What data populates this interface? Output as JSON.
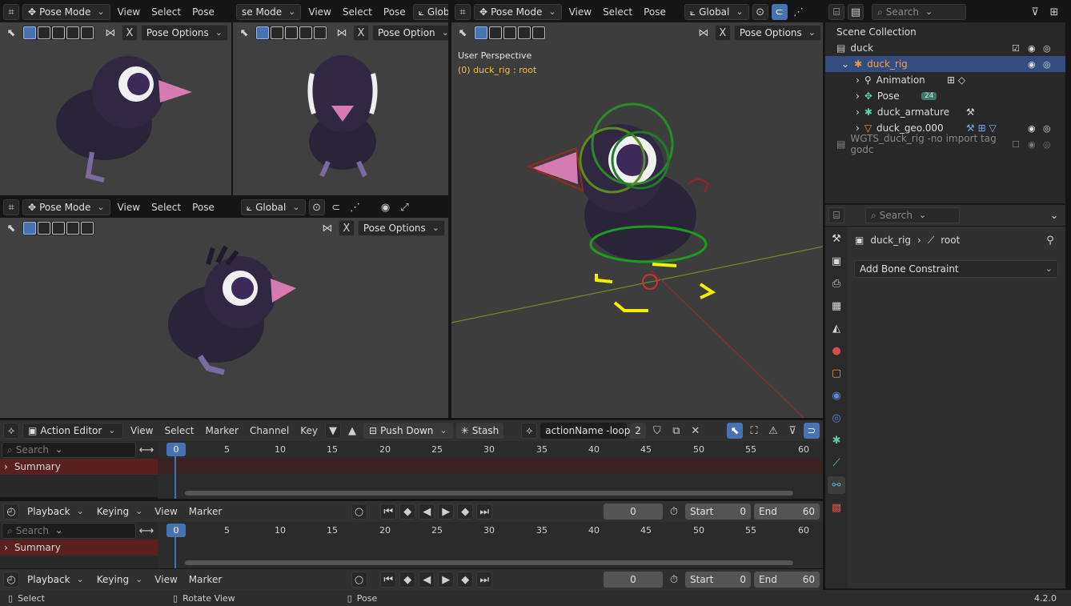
{
  "viewport_tl": {
    "mode": "Pose Mode",
    "menus": [
      "View",
      "Select",
      "Pose"
    ],
    "pose_options": "Pose Options"
  },
  "viewport_tm": {
    "mode": "se Mode",
    "menus": [
      "View",
      "Select",
      "Pose"
    ],
    "orient": "Globa",
    "pose_options": "Pose Option"
  },
  "viewport_bl": {
    "mode": "Pose Mode",
    "menus": [
      "View",
      "Select",
      "Pose"
    ],
    "orient": "Global",
    "pose_options": "Pose Options"
  },
  "viewport_main": {
    "mode": "Pose Mode",
    "menus": [
      "View",
      "Select",
      "Pose"
    ],
    "orient": "Global",
    "pose_options": "Pose Options",
    "perspective": "User Perspective",
    "object_info": "(0) duck_rig : root"
  },
  "outliner": {
    "search_placeholder": "Search",
    "root": "Scene Collection",
    "items": [
      {
        "label": "duck"
      },
      {
        "label": "duck_rig"
      },
      {
        "label": "Animation"
      },
      {
        "label": "Pose",
        "badge": "24"
      },
      {
        "label": "duck_armature"
      },
      {
        "label": "duck_geo.000"
      },
      {
        "label": "WGTS_duck_rig -no import tag godc"
      }
    ]
  },
  "properties": {
    "search_placeholder": "Search",
    "object": "duck_rig",
    "bone": "root",
    "add_constraint": "Add Bone Constraint"
  },
  "action_editor": {
    "mode": "Action Editor",
    "menus": [
      "View",
      "Select",
      "Marker",
      "Channel",
      "Key"
    ],
    "push_down": "Push Down",
    "stash": "Stash",
    "action_name": "actionName -loop",
    "users": "2",
    "search_placeholder": "Search",
    "summary": "Summary",
    "current_frame": "0",
    "ticks": [
      "5",
      "10",
      "15",
      "20",
      "25",
      "30",
      "35",
      "40",
      "45",
      "50",
      "55",
      "60"
    ]
  },
  "timeline1": {
    "menus": [
      "Playback",
      "Keying",
      "View",
      "Marker"
    ],
    "frame": "0",
    "start_label": "Start",
    "start": "0",
    "end_label": "End",
    "end": "60"
  },
  "timeline_editor2": {
    "search_placeholder": "Search",
    "summary": "Summary",
    "current_frame": "0",
    "ticks": [
      "5",
      "10",
      "15",
      "20",
      "25",
      "30",
      "35",
      "40",
      "45",
      "50",
      "55",
      "60"
    ]
  },
  "timeline2": {
    "menus": [
      "Playback",
      "Keying",
      "View",
      "Marker"
    ],
    "frame": "0",
    "start_label": "Start",
    "start": "0",
    "end_label": "End",
    "end": "60"
  },
  "status_bar": {
    "select": "Select",
    "rotate": "Rotate View",
    "pose": "Pose",
    "version": "4.2.0"
  }
}
